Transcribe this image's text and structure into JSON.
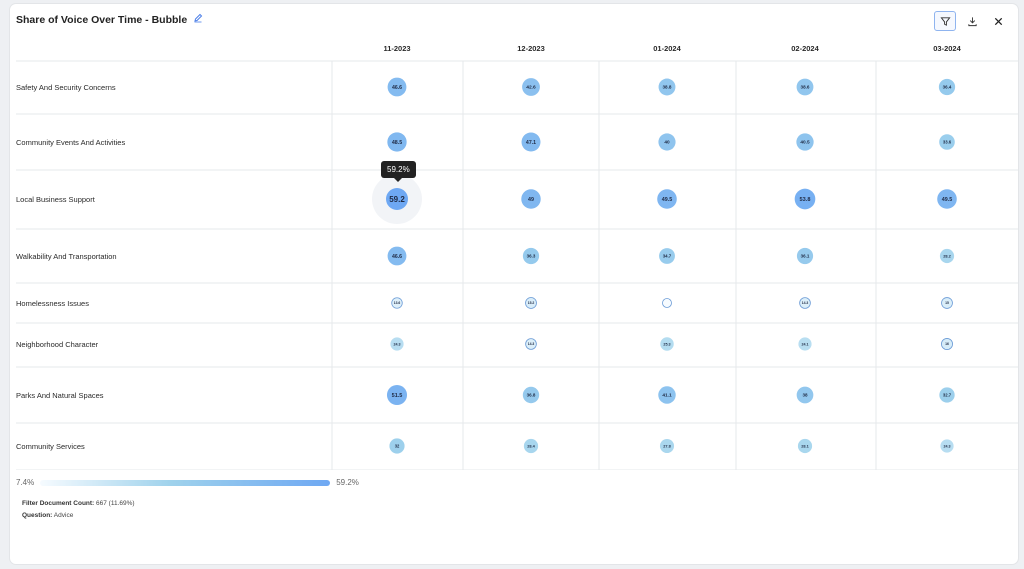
{
  "header": {
    "title": "Share of Voice Over Time - Bubble",
    "icons": [
      "edit-icon",
      "filter-icon",
      "download-icon",
      "close-icon"
    ]
  },
  "chart_data": {
    "type": "bubble-matrix",
    "columns": [
      "11-2023",
      "12-2023",
      "01-2024",
      "02-2024",
      "03-2024"
    ],
    "rows": [
      {
        "label": "Safety And Security Concerns",
        "values": [
          46.6,
          42.6,
          38.8,
          38.6,
          36.4
        ]
      },
      {
        "label": "Community Events And Activities",
        "values": [
          48.5,
          47.1,
          40,
          40.5,
          33.6
        ]
      },
      {
        "label": "Local Business Support",
        "values": [
          59.2,
          49,
          49.5,
          53.8,
          49.5
        ]
      },
      {
        "label": "Walkability And Transportation",
        "values": [
          46.6,
          36.3,
          34.7,
          36.1,
          28.2
        ]
      },
      {
        "label": "Homelessness Issues",
        "values": [
          13.6,
          15.2,
          7.4,
          14.3,
          15
        ]
      },
      {
        "label": "Neighborhood Character",
        "values": [
          24.3,
          14.3,
          25.3,
          24.1,
          16
        ]
      },
      {
        "label": "Parks And Natural Spaces",
        "values": [
          51.5,
          36.8,
          41.1,
          38,
          32.7
        ]
      },
      {
        "label": "Community Services",
        "values": [
          32,
          28.4,
          27.8,
          28.1,
          24.3
        ]
      }
    ],
    "display_labels": [
      [
        "46.6",
        "42.6",
        "38.8",
        "38.6",
        "36.4"
      ],
      [
        "48.5",
        "47.1",
        "40",
        "40.5",
        "33.6"
      ],
      [
        "59.2",
        "49",
        "49.5",
        "53.8",
        "49.5"
      ],
      [
        "46.6",
        "36.3",
        "34.7",
        "36.1",
        "28.2"
      ],
      [
        "13.6",
        "15.2",
        "",
        "14.3",
        "15"
      ],
      [
        "24.3",
        "14.3",
        "25.3",
        "24.1",
        "16"
      ],
      [
        "51.5",
        "36.8",
        "41.1",
        "38",
        "32.7"
      ],
      [
        "32",
        "28.4",
        "27.8",
        "28.1",
        "24.3"
      ]
    ],
    "scale": {
      "min": 7.4,
      "max": 59.2,
      "min_label": "7.4%",
      "max_label": "59.2%"
    },
    "colors": {
      "low": "#f6fbff",
      "mid": "#9fd2ec",
      "high": "#6ea8f3",
      "grid": "#e6e8eb"
    },
    "tooltip": {
      "row": 2,
      "col": 0,
      "text": "59.2%"
    }
  },
  "meta": {
    "filter_label": "Filter Document Count:",
    "filter_value": "667 (11.69%)",
    "question_label": "Question:",
    "question_value": "Advice"
  }
}
